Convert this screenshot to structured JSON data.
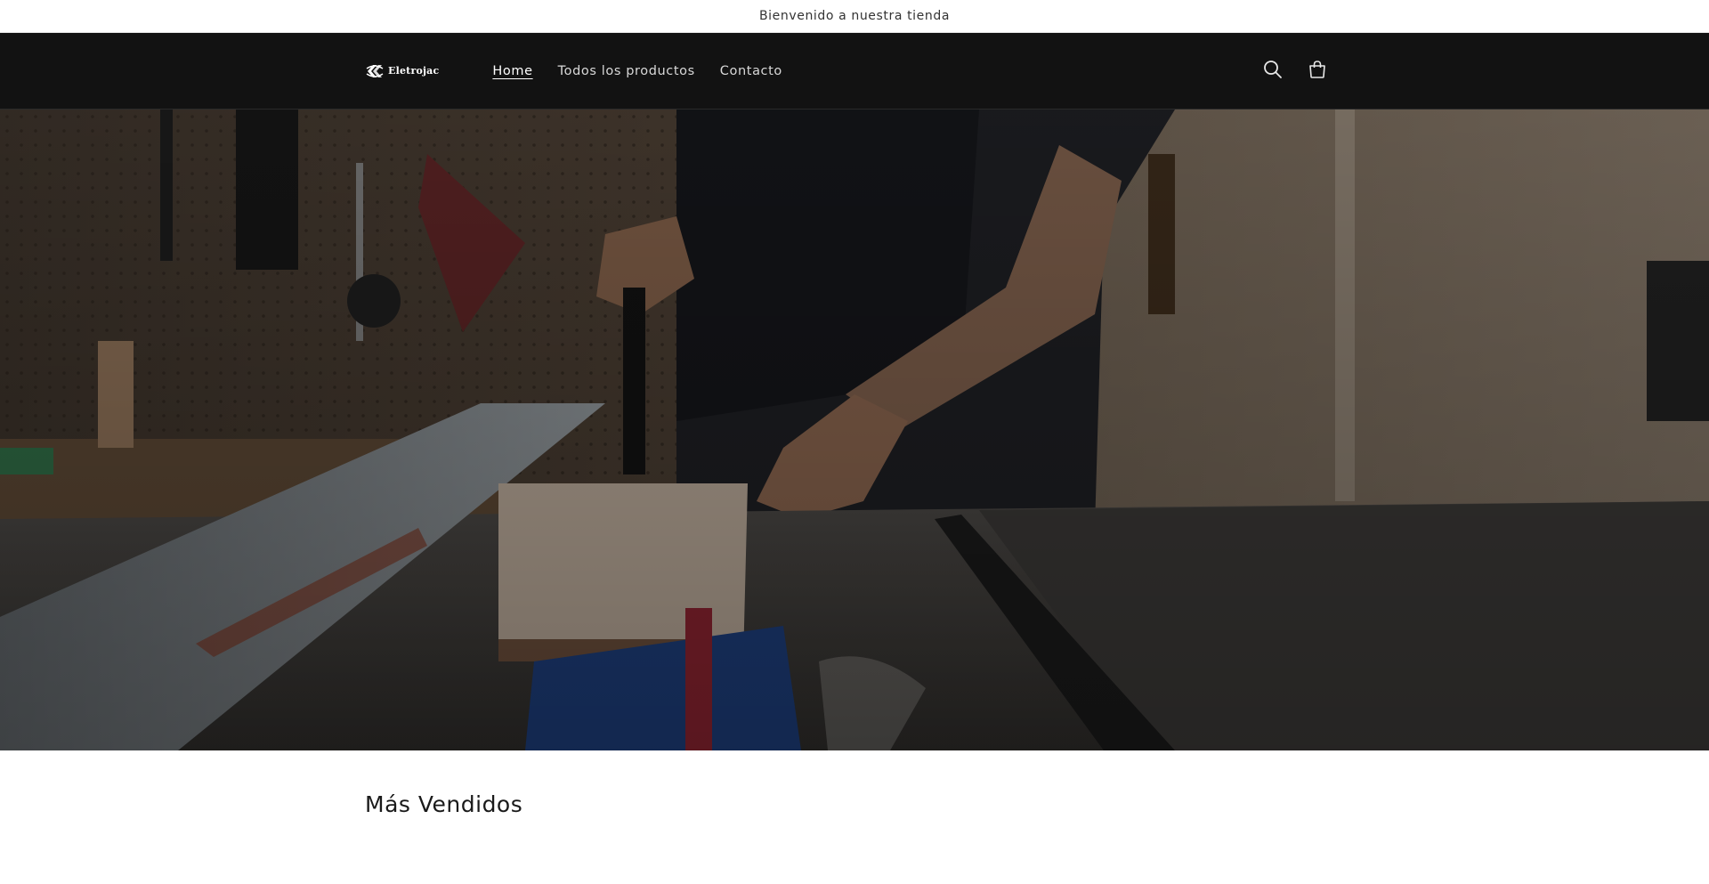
{
  "announcement": {
    "text": "Bienvenido a nuestra tienda"
  },
  "header": {
    "logo_text": "Eletrojac",
    "nav": [
      {
        "label": "Home",
        "active": true
      },
      {
        "label": "Todos los productos",
        "active": false
      },
      {
        "label": "Contacto",
        "active": false
      }
    ],
    "icons": [
      "search-icon",
      "cart-icon"
    ],
    "background_color": "#121212"
  },
  "hero": {
    "image_subject": "person cutting a wooden board on a table saw in a workshop with pegboard of tools"
  },
  "featured": {
    "title": "Más Vendidos"
  }
}
